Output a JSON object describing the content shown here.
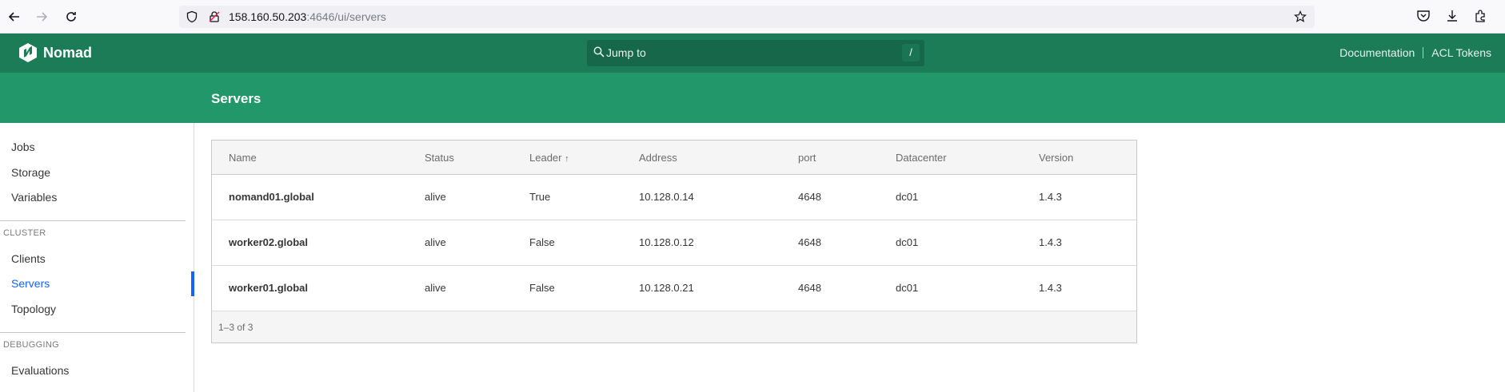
{
  "browser": {
    "url_host": "158.160.50.203",
    "url_rest": ":4646/ui/servers"
  },
  "header": {
    "app_name": "Nomad",
    "search_placeholder": "Jump to",
    "search_shortcut": "/",
    "links": [
      "Documentation",
      "ACL Tokens"
    ]
  },
  "page": {
    "title": "Servers"
  },
  "sidebar": {
    "top_items": [
      "Jobs",
      "Storage",
      "Variables"
    ],
    "cluster_label": "CLUSTER",
    "cluster_items": [
      "Clients",
      "Servers",
      "Topology"
    ],
    "active_item": "Servers",
    "debugging_label": "DEBUGGING",
    "debugging_items": [
      "Evaluations"
    ]
  },
  "table": {
    "columns": [
      "Name",
      "Status",
      "Leader",
      "Address",
      "port",
      "Datacenter",
      "Version"
    ],
    "sort_indicator": "↑",
    "rows": [
      {
        "name": "nomand01.global",
        "status": "alive",
        "leader": "True",
        "address": "10.128.0.14",
        "port": "4648",
        "datacenter": "dc01",
        "version": "1.4.3"
      },
      {
        "name": "worker02.global",
        "status": "alive",
        "leader": "False",
        "address": "10.128.0.12",
        "port": "4648",
        "datacenter": "dc01",
        "version": "1.4.3"
      },
      {
        "name": "worker01.global",
        "status": "alive",
        "leader": "False",
        "address": "10.128.0.21",
        "port": "4648",
        "datacenter": "dc01",
        "version": "1.4.3"
      }
    ],
    "pagination": "1–3 of 3"
  },
  "colors": {
    "nav_dark": "#1b7c57",
    "nav_light": "#21976a",
    "active_link": "#1563ff"
  }
}
